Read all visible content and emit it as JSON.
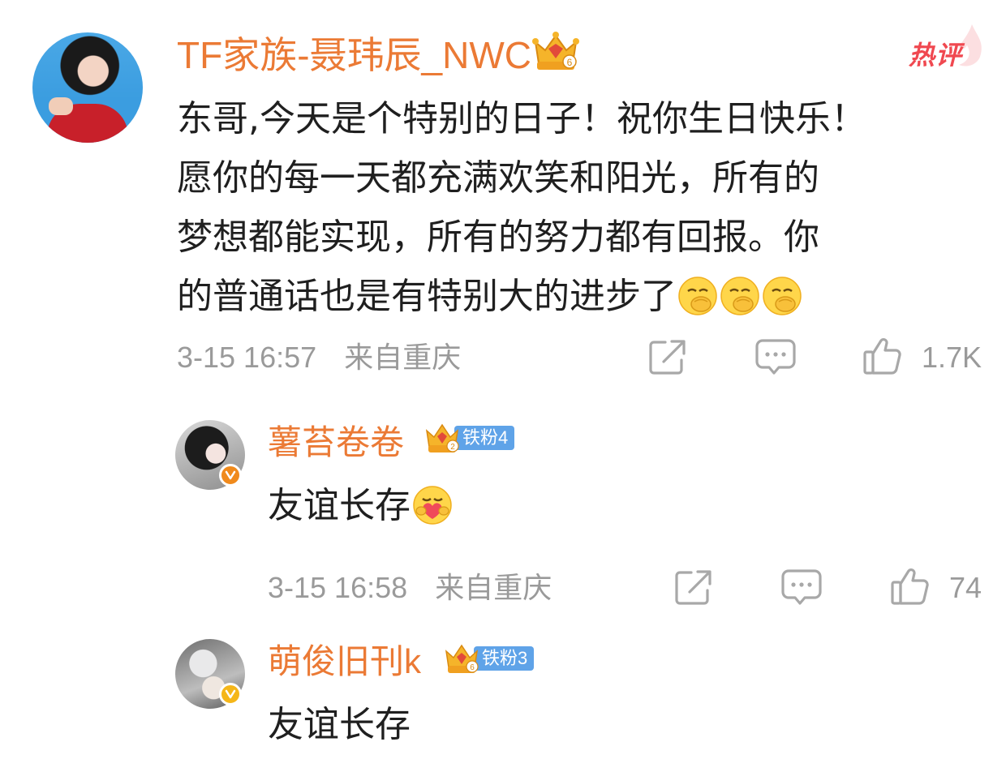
{
  "main_comment": {
    "username": "TF家族-聂玮辰_NWC",
    "crown_level": "6",
    "hot_label": "热评",
    "text_lines": [
      "东哥,今天是个特别的日子！祝你生日快乐！",
      "愿你的每一天都充满欢笑和阳光，所有的",
      "梦想都能实现，所有的努力都有回报。你",
      "的普通话也是有特别大的进步了"
    ],
    "emojis": [
      "grin-hand-emoji",
      "grin-hand-emoji",
      "grin-hand-emoji"
    ],
    "timestamp": "3-15 16:57",
    "location": "来自重庆",
    "like_count": "1.7K"
  },
  "replies": [
    {
      "username": "薯苔卷卷",
      "fan_level": "铁粉4",
      "crown_level": "2",
      "verified_color": "#f08a1c",
      "text": "友谊长存",
      "emoji": "hug-heart-emoji",
      "timestamp": "3-15 16:58",
      "location": "来自重庆",
      "like_count": "74"
    },
    {
      "username": "萌俊旧刊k",
      "fan_level": "铁粉3",
      "crown_level": "6",
      "verified_color": "#f5b619",
      "text": "友谊长存"
    }
  ],
  "colors": {
    "username": "#eb7a35",
    "meta_text": "#9a9a9a",
    "hot": "#f04850",
    "fan_badge": "#5fa3e8"
  },
  "icons": [
    "share-icon",
    "comment-icon",
    "like-icon"
  ]
}
